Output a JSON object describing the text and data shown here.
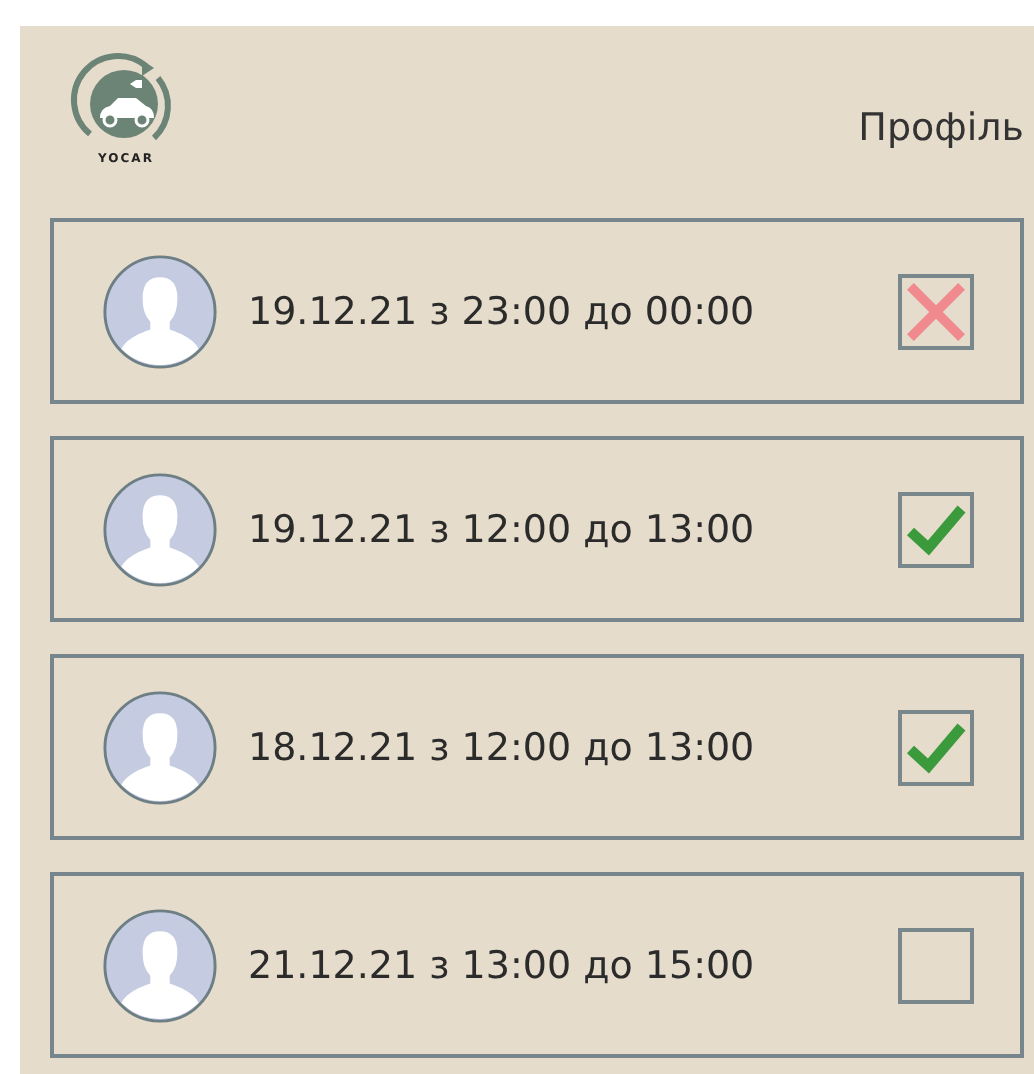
{
  "logo": {
    "text": "YOCAR"
  },
  "profile_link": "Профіль",
  "bookings": [
    {
      "text": "19.12.21 з 23:00 до 00:00",
      "kind": "rejected"
    },
    {
      "text": "19.12.21 з 12:00 до 13:00",
      "kind": "confirmed"
    },
    {
      "text": "18.12.21 з 12:00 до 13:00",
      "kind": "confirmed"
    },
    {
      "text": "21.12.21 з 13:00 до 15:00",
      "kind": "pending"
    }
  ]
}
